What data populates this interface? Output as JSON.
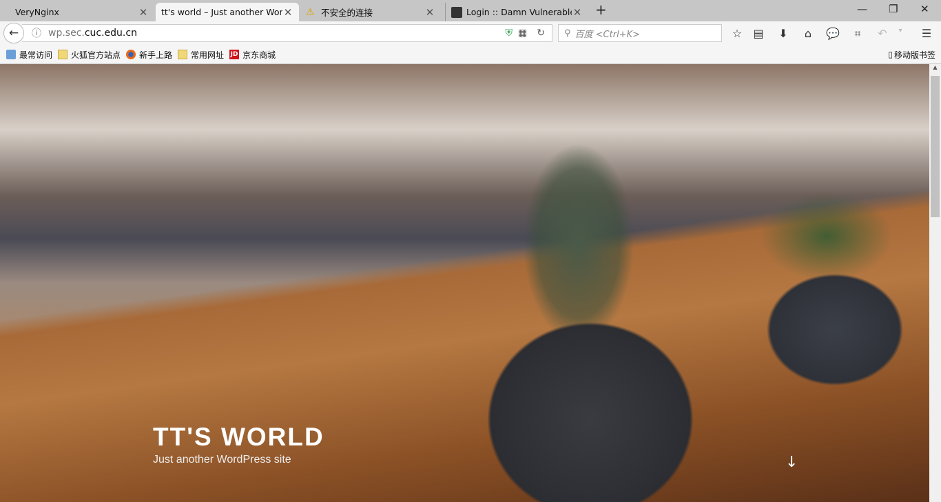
{
  "tabs": [
    {
      "title": "VeryNginx",
      "active": false
    },
    {
      "title": "tt's world – Just another Word",
      "active": true
    },
    {
      "title": "不安全的连接",
      "active": false,
      "icon": "warning-icon"
    },
    {
      "title": "Login :: Damn Vulnerable",
      "active": false
    }
  ],
  "window": {
    "new_tab": "+",
    "minimize": "—",
    "restore": "❐",
    "close": "✕"
  },
  "nav": {
    "url_domain_prefix": "wp.sec.",
    "url_domain": "cuc.edu.cn",
    "search_placeholder": "百度 <Ctrl+K>"
  },
  "bookmarks": [
    "最常访问",
    "火狐官方站点",
    "新手上路",
    "常用网址",
    "京东商城"
  ],
  "mobile_bookmarks": "移动版书签",
  "jd_logo": "JD",
  "hero": {
    "title": "TT'S WORLD",
    "subtitle": "Just another WordPress site",
    "scroll_icon": "↓"
  }
}
